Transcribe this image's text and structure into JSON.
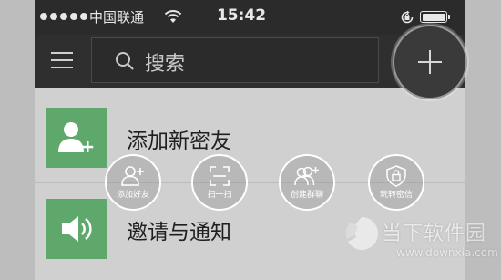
{
  "status_bar": {
    "carrier": "中国联通",
    "time": "15:42"
  },
  "nav": {
    "search_placeholder": "搜索"
  },
  "list": [
    {
      "label": "添加新密友",
      "icon": "add-friend-icon"
    },
    {
      "label": "邀请与通知",
      "icon": "speaker-icon"
    }
  ],
  "quick_actions": [
    {
      "label": "添加好友",
      "icon": "add-user-icon"
    },
    {
      "label": "扫一扫",
      "icon": "scan-icon"
    },
    {
      "label": "创建群聊",
      "icon": "group-chat-icon"
    },
    {
      "label": "玩转密信",
      "icon": "lock-shield-icon"
    }
  ],
  "watermark": {
    "cn": "当下软件园",
    "en": "www.downxia.com"
  },
  "colors": {
    "header_bg": "#2f2f2f",
    "tile_green": "#5fa86b",
    "list_bg": "#d0d0d0"
  }
}
